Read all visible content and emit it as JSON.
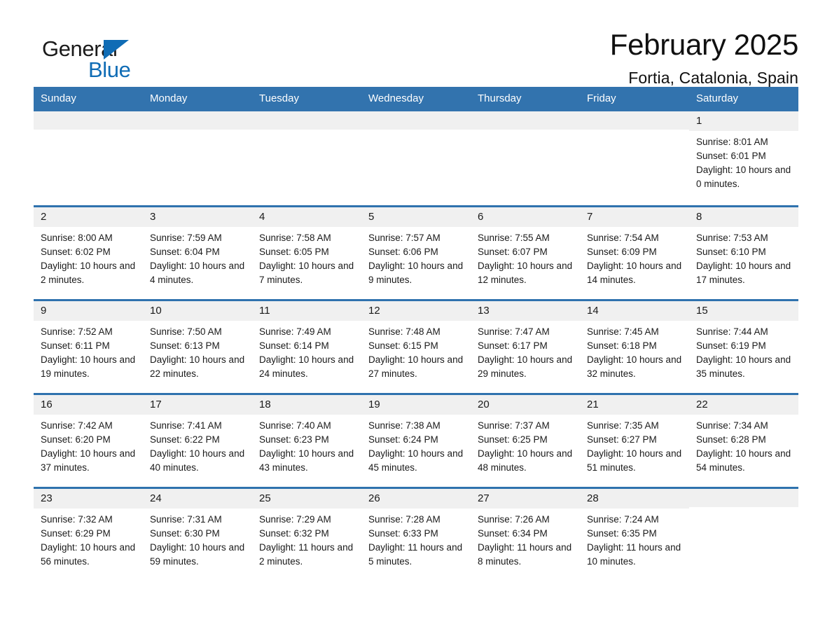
{
  "brand": {
    "name_part1": "General",
    "name_part2": "Blue",
    "accent_color": "#0f6cb5"
  },
  "header": {
    "title": "February 2025",
    "location": "Fortia, Catalonia, Spain"
  },
  "calendar": {
    "header_bg": "#3273ae",
    "week_border_color": "#2f72ae",
    "daynum_bg": "#f0f0f0",
    "weekdays": [
      "Sunday",
      "Monday",
      "Tuesday",
      "Wednesday",
      "Thursday",
      "Friday",
      "Saturday"
    ],
    "weeks": [
      [
        {
          "day": "",
          "empty": true
        },
        {
          "day": "",
          "empty": true
        },
        {
          "day": "",
          "empty": true
        },
        {
          "day": "",
          "empty": true
        },
        {
          "day": "",
          "empty": true
        },
        {
          "day": "",
          "empty": true
        },
        {
          "day": "1",
          "sunrise": "Sunrise: 8:01 AM",
          "sunset": "Sunset: 6:01 PM",
          "daylight": "Daylight: 10 hours and 0 minutes."
        }
      ],
      [
        {
          "day": "2",
          "sunrise": "Sunrise: 8:00 AM",
          "sunset": "Sunset: 6:02 PM",
          "daylight": "Daylight: 10 hours and 2 minutes."
        },
        {
          "day": "3",
          "sunrise": "Sunrise: 7:59 AM",
          "sunset": "Sunset: 6:04 PM",
          "daylight": "Daylight: 10 hours and 4 minutes."
        },
        {
          "day": "4",
          "sunrise": "Sunrise: 7:58 AM",
          "sunset": "Sunset: 6:05 PM",
          "daylight": "Daylight: 10 hours and 7 minutes."
        },
        {
          "day": "5",
          "sunrise": "Sunrise: 7:57 AM",
          "sunset": "Sunset: 6:06 PM",
          "daylight": "Daylight: 10 hours and 9 minutes."
        },
        {
          "day": "6",
          "sunrise": "Sunrise: 7:55 AM",
          "sunset": "Sunset: 6:07 PM",
          "daylight": "Daylight: 10 hours and 12 minutes."
        },
        {
          "day": "7",
          "sunrise": "Sunrise: 7:54 AM",
          "sunset": "Sunset: 6:09 PM",
          "daylight": "Daylight: 10 hours and 14 minutes."
        },
        {
          "day": "8",
          "sunrise": "Sunrise: 7:53 AM",
          "sunset": "Sunset: 6:10 PM",
          "daylight": "Daylight: 10 hours and 17 minutes."
        }
      ],
      [
        {
          "day": "9",
          "sunrise": "Sunrise: 7:52 AM",
          "sunset": "Sunset: 6:11 PM",
          "daylight": "Daylight: 10 hours and 19 minutes."
        },
        {
          "day": "10",
          "sunrise": "Sunrise: 7:50 AM",
          "sunset": "Sunset: 6:13 PM",
          "daylight": "Daylight: 10 hours and 22 minutes."
        },
        {
          "day": "11",
          "sunrise": "Sunrise: 7:49 AM",
          "sunset": "Sunset: 6:14 PM",
          "daylight": "Daylight: 10 hours and 24 minutes."
        },
        {
          "day": "12",
          "sunrise": "Sunrise: 7:48 AM",
          "sunset": "Sunset: 6:15 PM",
          "daylight": "Daylight: 10 hours and 27 minutes."
        },
        {
          "day": "13",
          "sunrise": "Sunrise: 7:47 AM",
          "sunset": "Sunset: 6:17 PM",
          "daylight": "Daylight: 10 hours and 29 minutes."
        },
        {
          "day": "14",
          "sunrise": "Sunrise: 7:45 AM",
          "sunset": "Sunset: 6:18 PM",
          "daylight": "Daylight: 10 hours and 32 minutes."
        },
        {
          "day": "15",
          "sunrise": "Sunrise: 7:44 AM",
          "sunset": "Sunset: 6:19 PM",
          "daylight": "Daylight: 10 hours and 35 minutes."
        }
      ],
      [
        {
          "day": "16",
          "sunrise": "Sunrise: 7:42 AM",
          "sunset": "Sunset: 6:20 PM",
          "daylight": "Daylight: 10 hours and 37 minutes."
        },
        {
          "day": "17",
          "sunrise": "Sunrise: 7:41 AM",
          "sunset": "Sunset: 6:22 PM",
          "daylight": "Daylight: 10 hours and 40 minutes."
        },
        {
          "day": "18",
          "sunrise": "Sunrise: 7:40 AM",
          "sunset": "Sunset: 6:23 PM",
          "daylight": "Daylight: 10 hours and 43 minutes."
        },
        {
          "day": "19",
          "sunrise": "Sunrise: 7:38 AM",
          "sunset": "Sunset: 6:24 PM",
          "daylight": "Daylight: 10 hours and 45 minutes."
        },
        {
          "day": "20",
          "sunrise": "Sunrise: 7:37 AM",
          "sunset": "Sunset: 6:25 PM",
          "daylight": "Daylight: 10 hours and 48 minutes."
        },
        {
          "day": "21",
          "sunrise": "Sunrise: 7:35 AM",
          "sunset": "Sunset: 6:27 PM",
          "daylight": "Daylight: 10 hours and 51 minutes."
        },
        {
          "day": "22",
          "sunrise": "Sunrise: 7:34 AM",
          "sunset": "Sunset: 6:28 PM",
          "daylight": "Daylight: 10 hours and 54 minutes."
        }
      ],
      [
        {
          "day": "23",
          "sunrise": "Sunrise: 7:32 AM",
          "sunset": "Sunset: 6:29 PM",
          "daylight": "Daylight: 10 hours and 56 minutes."
        },
        {
          "day": "24",
          "sunrise": "Sunrise: 7:31 AM",
          "sunset": "Sunset: 6:30 PM",
          "daylight": "Daylight: 10 hours and 59 minutes."
        },
        {
          "day": "25",
          "sunrise": "Sunrise: 7:29 AM",
          "sunset": "Sunset: 6:32 PM",
          "daylight": "Daylight: 11 hours and 2 minutes."
        },
        {
          "day": "26",
          "sunrise": "Sunrise: 7:28 AM",
          "sunset": "Sunset: 6:33 PM",
          "daylight": "Daylight: 11 hours and 5 minutes."
        },
        {
          "day": "27",
          "sunrise": "Sunrise: 7:26 AM",
          "sunset": "Sunset: 6:34 PM",
          "daylight": "Daylight: 11 hours and 8 minutes."
        },
        {
          "day": "28",
          "sunrise": "Sunrise: 7:24 AM",
          "sunset": "Sunset: 6:35 PM",
          "daylight": "Daylight: 11 hours and 10 minutes."
        },
        {
          "day": "",
          "empty": true
        }
      ]
    ]
  }
}
